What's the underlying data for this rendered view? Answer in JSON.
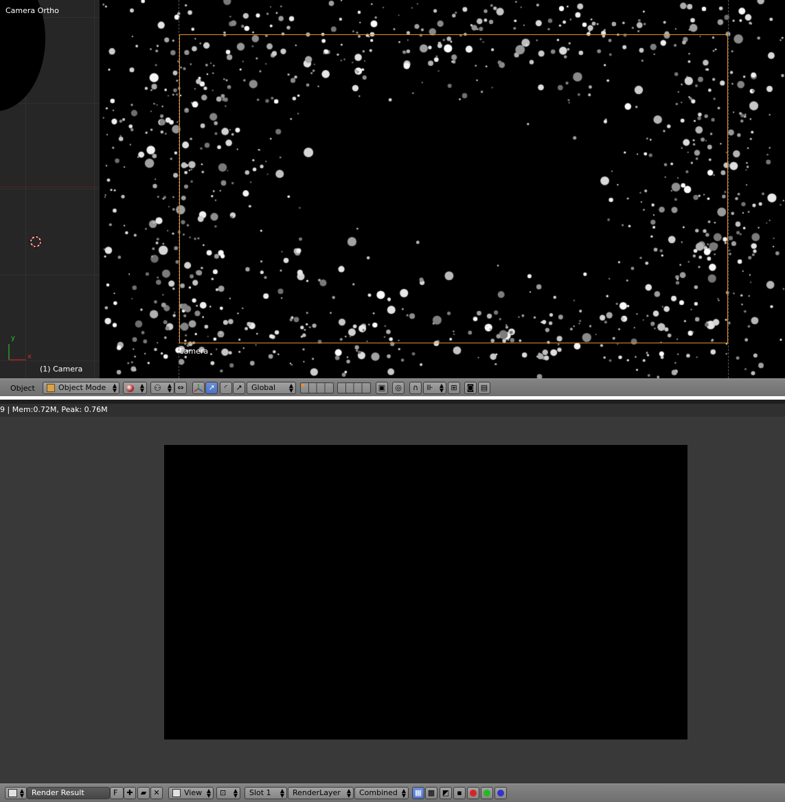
{
  "viewport": {
    "view_name": "Camera Ortho",
    "active_object": "(1) Camera",
    "camera_label": "Camera",
    "axis_y": "y",
    "axis_x": "x"
  },
  "header_3d": {
    "menu_object": "Object",
    "mode": "Object Mode",
    "orientation": "Global"
  },
  "image_editor": {
    "info_text": "9 | Mem:0.72M, Peak: 0.76M",
    "image_name": "Render Result",
    "fake_user": "F",
    "view_menu": "View",
    "slot": "Slot 1",
    "render_layer": "RenderLayer",
    "pass": "Combined"
  },
  "colors": {
    "camera_frame": "#e7922a",
    "active_button": "#5a7fcf",
    "header_gray": "#7a7a7a"
  }
}
